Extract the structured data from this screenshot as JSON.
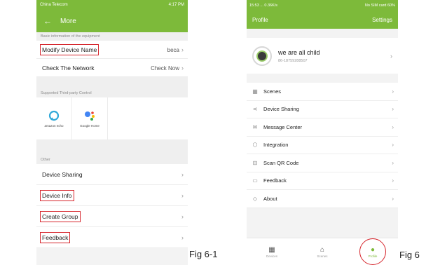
{
  "phone1": {
    "status_carrier": "China Telecom",
    "status_right": "4:17 PM",
    "back_glyph": "←",
    "title": "More",
    "section_basic": "Basic information of the equipment",
    "modify_label": "Modify Device Name",
    "modify_value": "beca",
    "network_label": "Check The Network",
    "network_value": "Check Now",
    "section_third_party": "Supported Third-party Control",
    "alexa_caption": "amazon echo",
    "google_caption": "Google Home",
    "section_other": "Other",
    "other_items": [
      "Device Sharing",
      "Device Info",
      "Create Group",
      "Feedback"
    ]
  },
  "phone2": {
    "status_left": "15:53 ... 0.36K/s",
    "status_right": "No SIM card  60%",
    "title": "Profile",
    "settings": "Settings",
    "user_name": "we are all child",
    "user_phone": "86-18759288507",
    "menu": [
      {
        "label": "Scenes",
        "icon": "grid-icon"
      },
      {
        "label": "Device Sharing",
        "icon": "share-icon"
      },
      {
        "label": "Message Center",
        "icon": "mail-icon"
      },
      {
        "label": "Integration",
        "icon": "cube-icon"
      },
      {
        "label": "Scan QR Code",
        "icon": "scan-icon"
      },
      {
        "label": "Feedback",
        "icon": "feedback-icon"
      },
      {
        "label": "About",
        "icon": "diamond-icon"
      }
    ],
    "tabs": [
      "Devices",
      "Scenes",
      "Profile"
    ]
  },
  "figures": [
    "Fig 6-1",
    "Fig 6"
  ],
  "colors": {
    "accent": "#7dba3a",
    "highlight": "#d6252c"
  }
}
